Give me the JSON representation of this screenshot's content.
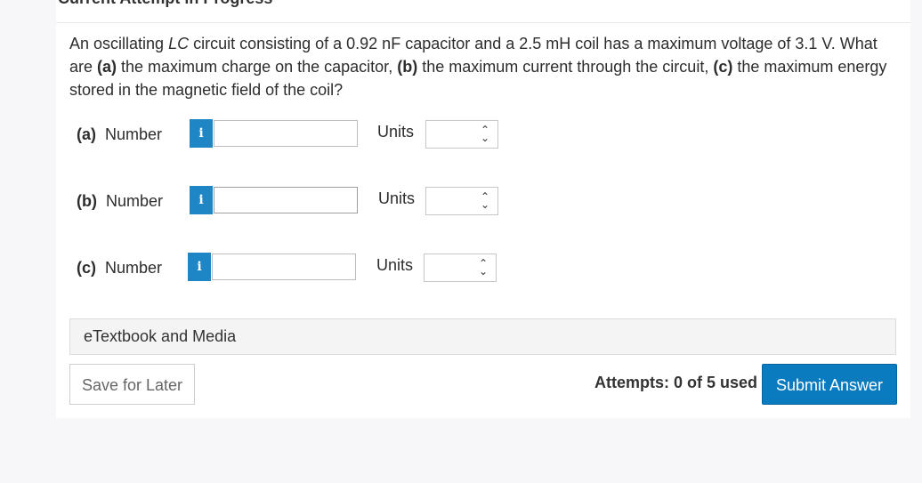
{
  "header": {
    "title": "Current Attempt in Progress"
  },
  "question": {
    "t1": "An oscillating ",
    "lc": "LC",
    "t2": " circuit consisting of a 0.92 nF capacitor and a 2.5 mH coil has a maximum voltage of 3.1 V. What are ",
    "a": "(a)",
    "t3": " the maximum charge on the capacitor, ",
    "b": "(b)",
    "t4": " the maximum current through the circuit, ",
    "c": "(c)",
    "t5": " the maximum energy stored in the magnetic field of the coil?"
  },
  "parts": [
    {
      "letter": "(a)",
      "label": "Number",
      "info_icon": "i",
      "value": "",
      "units_label": "Units",
      "units_value": ""
    },
    {
      "letter": "(b)",
      "label": "Number",
      "info_icon": "i",
      "value": "",
      "units_label": "Units",
      "units_value": ""
    },
    {
      "letter": "(c)",
      "label": "Number",
      "info_icon": "i",
      "value": "",
      "units_label": "Units",
      "units_value": ""
    }
  ],
  "etextbook": {
    "label": "eTextbook and Media"
  },
  "footer": {
    "save_label": "Save for Later",
    "attempts_text": "Attempts: 0 of 5 used",
    "submit_label": "Submit Answer"
  },
  "colors": {
    "accent": "#1f86c6",
    "submit": "#0a7bbf",
    "page_background": "#f7f7f9"
  }
}
